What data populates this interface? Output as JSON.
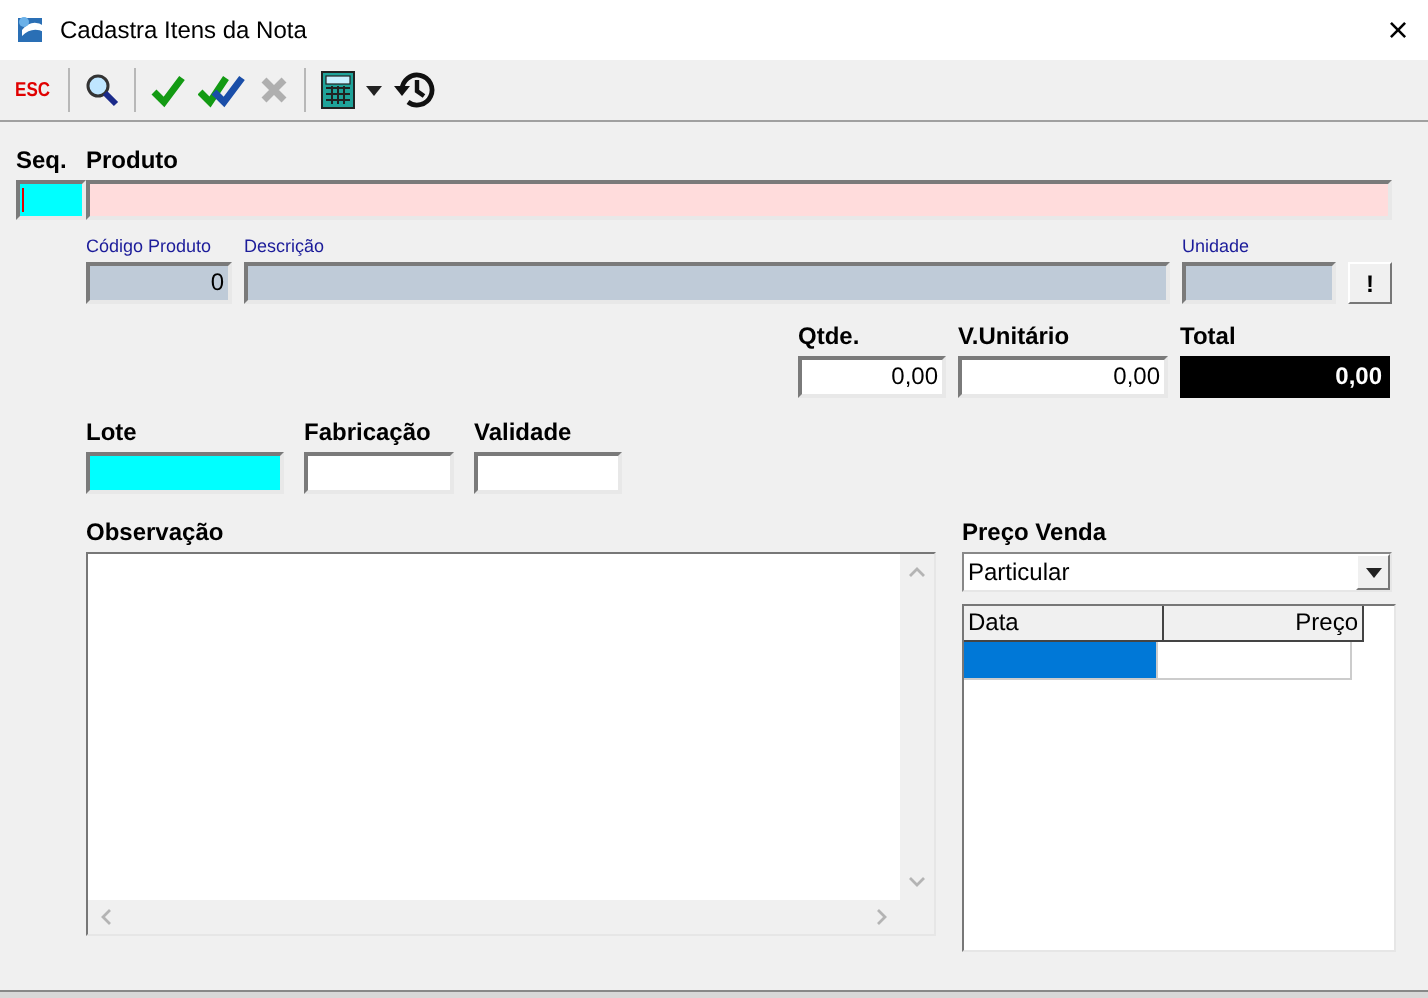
{
  "window": {
    "title": "Cadastra Itens da Nota",
    "close": "×"
  },
  "toolbar": [
    {
      "kind": "esc",
      "label": "ESC",
      "disabled": false
    },
    {
      "kind": "sep"
    },
    {
      "kind": "search",
      "disabled": false
    },
    {
      "kind": "sep"
    },
    {
      "kind": "check",
      "disabled": false
    },
    {
      "kind": "check-all",
      "disabled": false
    },
    {
      "kind": "cancel",
      "disabled": true
    },
    {
      "kind": "sep"
    },
    {
      "kind": "calculator",
      "disabled": false
    },
    {
      "kind": "caret",
      "disabled": false
    },
    {
      "kind": "history",
      "disabled": false
    }
  ],
  "seq": {
    "label": "Seq.",
    "kind": "required",
    "focused": true
  },
  "produto": {
    "label": "Produto",
    "kind": "error"
  },
  "codigo": {
    "label": "Código Produto",
    "value": "0",
    "kind": "readonly"
  },
  "descricao": {
    "label": "Descrição",
    "kind": "readonly"
  },
  "unidade": {
    "label": "Unidade",
    "kind": "readonly"
  },
  "info_button": "!",
  "qtde": {
    "label": "Qtde.",
    "value": "0,00",
    "kind": "input"
  },
  "valor_unitario": {
    "label": "V.Unitário",
    "value": "0,00",
    "kind": "input"
  },
  "total": {
    "label": "Total",
    "value": "0,00",
    "kind": "total"
  },
  "lote": {
    "label": "Lote",
    "kind": "required"
  },
  "fabricacao": {
    "label": "Fabricação",
    "kind": "input"
  },
  "validade": {
    "label": "Validade",
    "kind": "input"
  },
  "observacao": {
    "label": "Observação"
  },
  "preco_venda": {
    "label": "Preço Venda",
    "value": "Particular",
    "columns": [
      "Data",
      "Preço"
    ],
    "rows": [
      {
        "selected": true
      }
    ]
  }
}
